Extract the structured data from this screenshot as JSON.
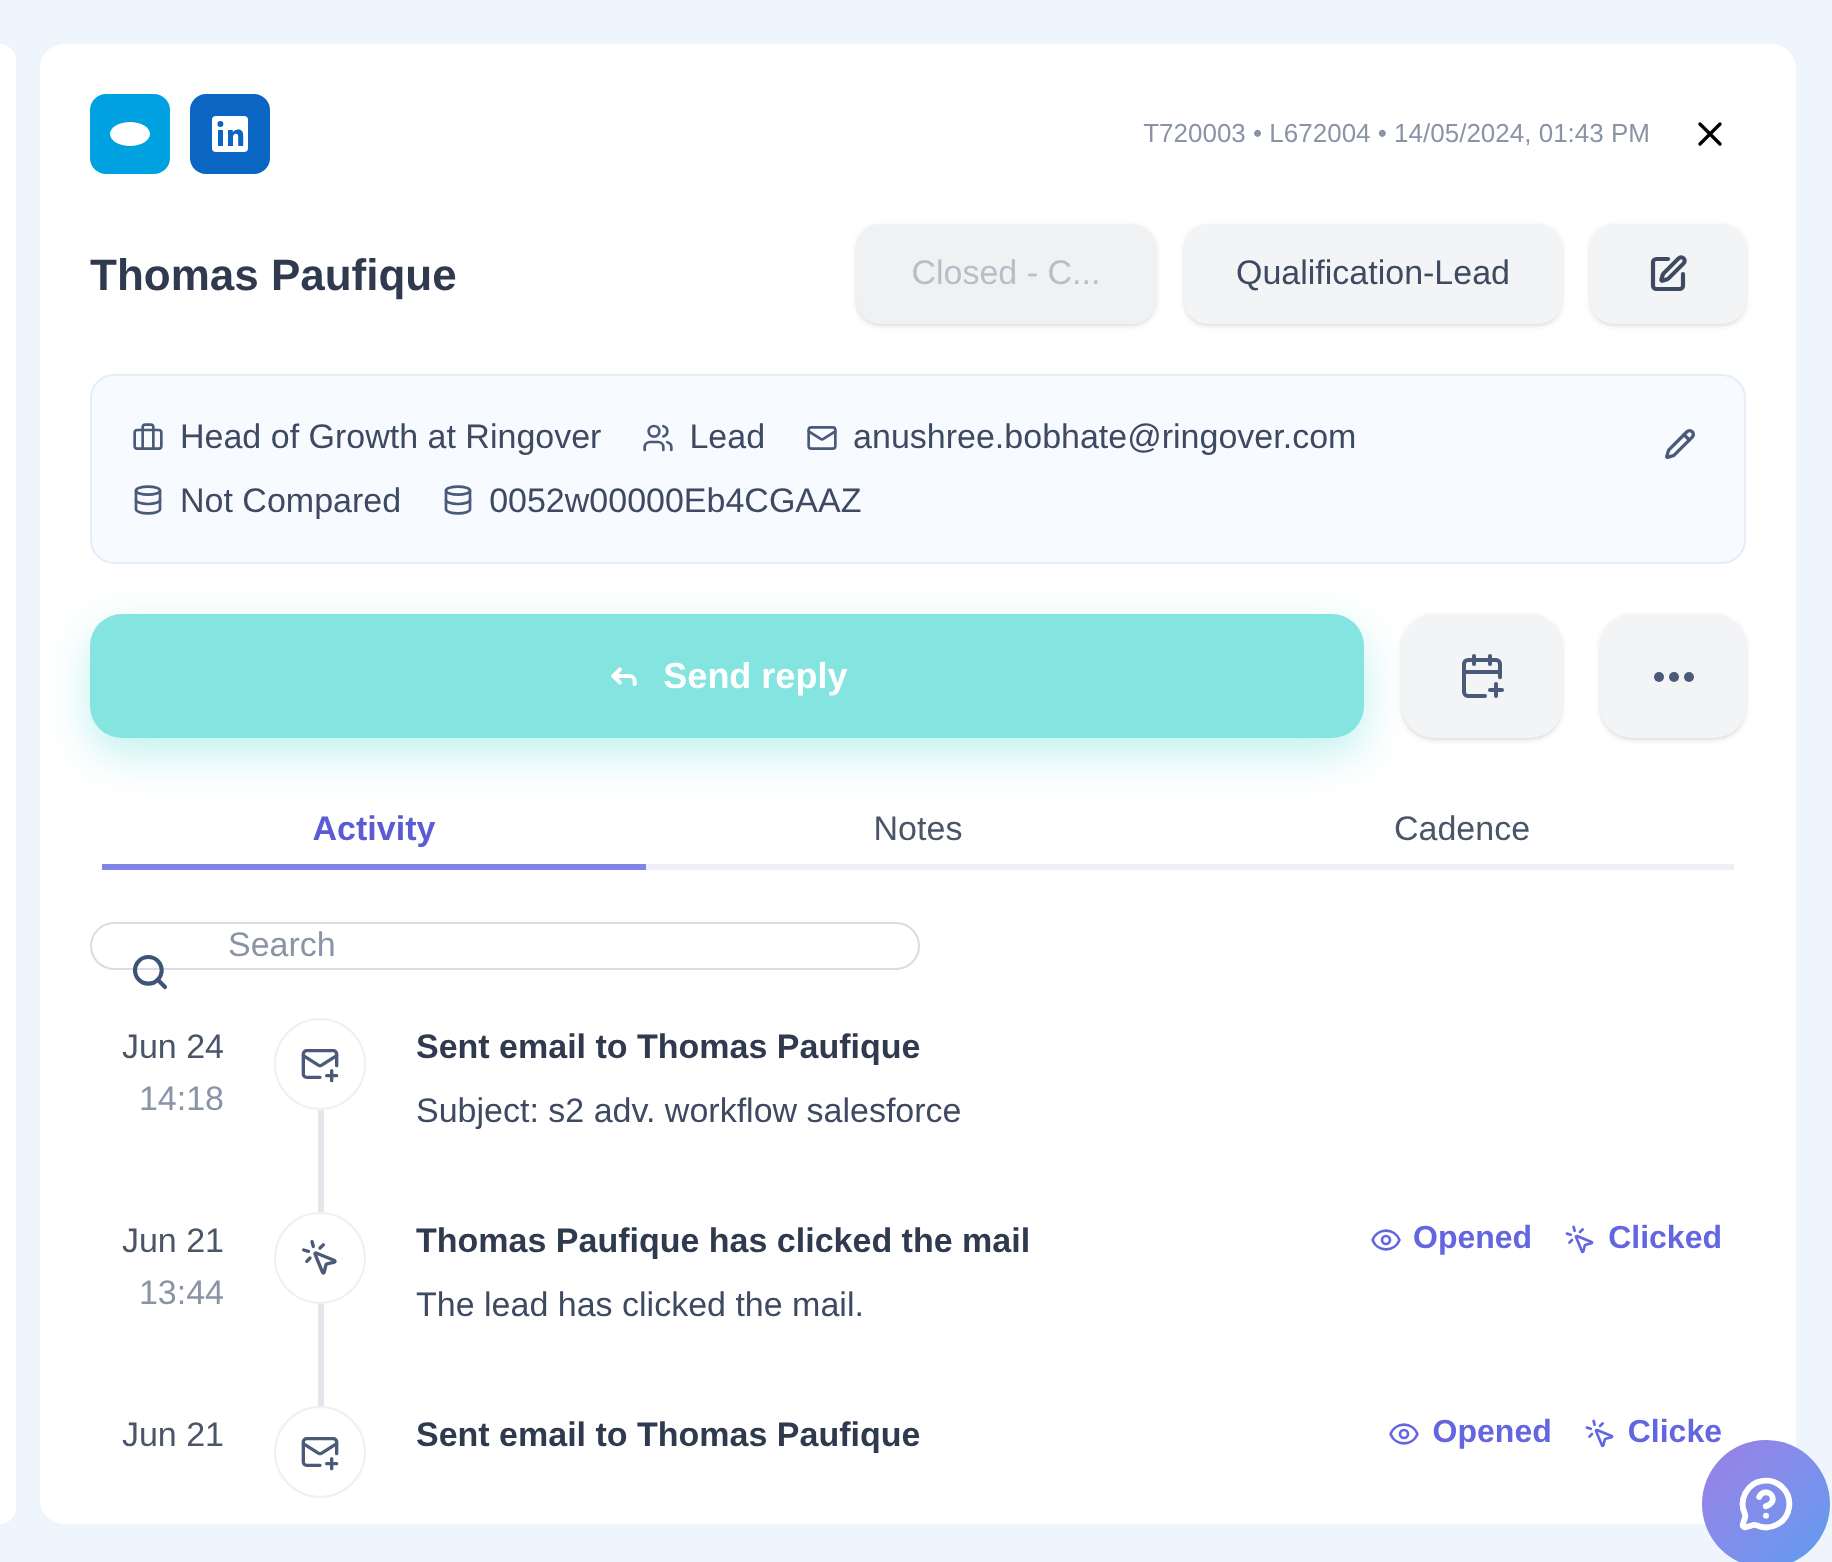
{
  "header": {
    "meta": "T720003 • L672004 • 14/05/2024, 01:43 PM"
  },
  "contact": {
    "name": "Thomas Paufique"
  },
  "status_buttons": [
    {
      "label": "Closed - C...",
      "disabled": true
    },
    {
      "label": "Qualification-Lead",
      "disabled": false
    }
  ],
  "detail_lines": [
    [
      {
        "kind": "job",
        "text": "Head of Growth at Ringover"
      },
      {
        "kind": "role",
        "text": "Lead"
      },
      {
        "kind": "email",
        "text": "anushree.bobhate@ringover.com"
      }
    ],
    [
      {
        "kind": "db",
        "text": "Not Compared"
      },
      {
        "kind": "db",
        "text": "0052w00000Eb4CGAAZ"
      }
    ]
  ],
  "send_reply": {
    "label": "Send reply"
  },
  "tabs": [
    {
      "label": "Activity",
      "selected": true
    },
    {
      "label": "Notes",
      "selected": false
    },
    {
      "label": "Cadence",
      "selected": false
    }
  ],
  "search": {
    "placeholder": "Search"
  },
  "activities": [
    {
      "kind": "email",
      "date": "Jun 24",
      "time": "14:18",
      "title": "Sent email to Thomas Paufique",
      "subtitle": "Subject: s2 adv. workflow salesforce"
    },
    {
      "kind": "click",
      "date": "Jun 21",
      "time": "13:44",
      "title": "Thomas Paufique has clicked the mail",
      "subtitle": "The lead has clicked the mail.",
      "badges": [
        {
          "kind": "opened",
          "label": "Opened"
        },
        {
          "kind": "clicked",
          "label": "Clicked"
        }
      ]
    },
    {
      "kind": "email",
      "date": "Jun 21",
      "title": "Sent email to Thomas Paufique",
      "badges": [
        {
          "kind": "opened",
          "label": "Opened"
        },
        {
          "kind": "clicked",
          "label": "Clicke"
        }
      ]
    }
  ]
}
